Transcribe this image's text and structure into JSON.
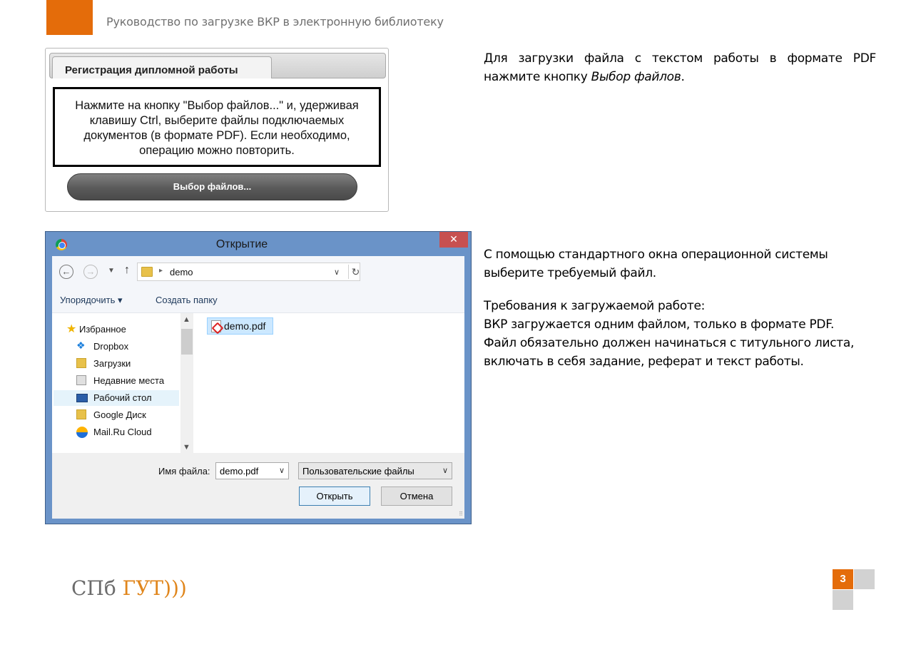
{
  "header": {
    "title": "Руководство по загрузке ВКР в электронную библиотеку",
    "accent_color": "#e46c0a"
  },
  "registration": {
    "tab_label": "Регистрация дипломной работы",
    "message": "Нажмите на кнопку \"Выбор файлов...\" и, удерживая клавишу Ctrl, выберите файлы подключаемых документов (в формате PDF). Если необходимо, операцию можно повторить.",
    "button_label": "Выбор файлов..."
  },
  "instructions": {
    "p1_text": "Для загрузки файла с текстом работы в формате PDF нажмите кнопку ",
    "p1_emphasis": "Выбор файлов",
    "p1_end": ".",
    "p2": "С помощью стандартного окна операционной системы выберите требуемый файл.",
    "p3_line1": "Требования к загружаемой работе:",
    "p3_line2": "ВКР загружается одним файлом, только в формате PDF.",
    "p3_line3": "Файл обязательно должен начинаться с титульного листа, включать в себя задание, реферат и текст работы."
  },
  "dialog": {
    "title": "Открытие",
    "close_glyph": "✕",
    "address": {
      "folder": "demo"
    },
    "toolbar": {
      "organize": "Упорядочить ▾",
      "new_folder": "Создать папку"
    },
    "nav_items": [
      {
        "label": "Избранное",
        "icon": "star-icon"
      },
      {
        "label": "Dropbox",
        "icon": "dropbox-icon"
      },
      {
        "label": "Загрузки",
        "icon": "downloads-icon"
      },
      {
        "label": "Недавние места",
        "icon": "recent-places-icon"
      },
      {
        "label": "Рабочий стол",
        "icon": "desktop-icon"
      },
      {
        "label": "Google Диск",
        "icon": "google-drive-icon"
      },
      {
        "label": "Mail.Ru Cloud",
        "icon": "mailru-cloud-icon"
      }
    ],
    "files": [
      {
        "name": "demo.pdf",
        "icon": "pdf-icon"
      }
    ],
    "filename_label": "Имя файла:",
    "filename_value": "demo.pdf",
    "filetype_value": "Пользовательские файлы",
    "open_button": "Открыть",
    "cancel_button": "Отмена"
  },
  "footer": {
    "logo_part1": "СПб",
    "logo_part2": "ГУТ",
    "logo_part3": ")))",
    "page_number": "3",
    "logo_gray": "#6b6b6b",
    "logo_orange": "#e0861c"
  }
}
